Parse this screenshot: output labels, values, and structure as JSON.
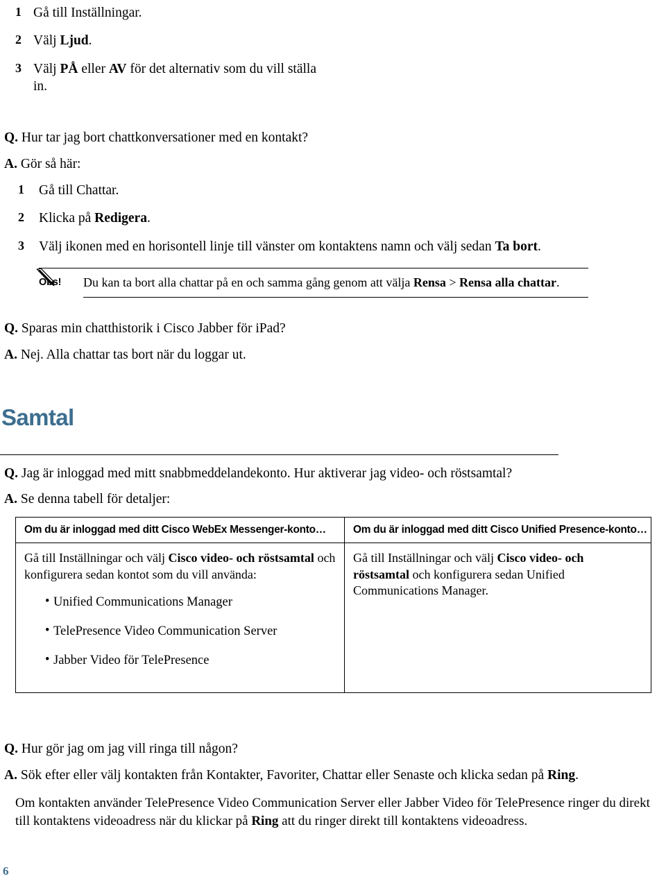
{
  "document": {
    "page_number": "6",
    "accent_color": "#3c6e8f",
    "text_color": "#000000"
  },
  "top_steps": {
    "items": [
      {
        "num": "1",
        "text_plain": "Gå till Inställningar.",
        "text_html": "Gå till Inställningar."
      },
      {
        "num": "2",
        "text_plain": "Välj Ljud.",
        "text_html": "Välj <b>Ljud</b>."
      },
      {
        "num": "3",
        "text_plain": "Välj PÅ eller AV för det alternativ som du vill ställa in.",
        "text_html": "Välj <b>PÅ</b> eller <b>AV</b> för det alternativ som du vill ställa in."
      }
    ]
  },
  "faq_chat_delete": {
    "question_tag": "Q.",
    "question": "Hur tar jag bort chattkonversationer med en kontakt?",
    "answer_tag": "A.",
    "answer": "Gör så här:",
    "steps": [
      {
        "num": "1",
        "text_plain": "Gå till Chattar.",
        "text_html": "Gå till Chattar."
      },
      {
        "num": "2",
        "text_plain": "Klicka på Redigera.",
        "text_html": "Klicka på <b>Redigera</b>."
      },
      {
        "num": "3",
        "text_plain": "Välj ikonen med en horisontell linje till vänster om kontaktens namn och välj sedan Ta bort.",
        "text_html": "Välj ikonen med en horisontell linje till vänster om kontaktens namn och välj sedan <b>Ta bort</b>."
      }
    ]
  },
  "note": {
    "icon": "pencil-icon",
    "label": "Obs!",
    "text_plain": "Du kan ta bort alla chattar på en och samma gång genom att välja Rensa > Rensa alla chattar.",
    "text_html": "Du kan ta bort alla chattar på en och samma gång genom att välja <b>Rensa</b> &gt; <b>Rensa alla chattar</b>."
  },
  "faq_chat_history": {
    "question_tag": "Q.",
    "question": "Sparas min chatthistorik i Cisco Jabber för iPad?",
    "answer_tag": "A.",
    "answer": "Nej. Alla chattar tas bort när du loggar ut."
  },
  "section": {
    "heading": "Samtal"
  },
  "faq_video_voice": {
    "question_tag": "Q.",
    "question": "Jag är inloggad med mitt snabbmeddelandekonto. Hur aktiverar jag video- och röstsamtal?",
    "answer_tag": "A.",
    "answer": "Se denna tabell för detaljer:"
  },
  "account_table": {
    "headers": [
      "Om du är inloggad med ditt Cisco WebEx Messenger-konto…",
      "Om du är inloggad med ditt Cisco Unified Presence-konto…"
    ],
    "rows": [
      {
        "left": {
          "text_plain": "Gå till Inställningar och välj Cisco video- och röstsamtal och konfigurera sedan kontot som du vill använda:",
          "text_html": "Gå till Inställningar och välj <b>Cisco video- och röstsamtal</b> och konfigurera sedan kontot som du vill använda:",
          "bullets": [
            "Unified Communications Manager",
            "TelePresence Video Communication Server",
            "Jabber Video för TelePresence"
          ]
        },
        "right": {
          "text_plain": "Gå till Inställningar och välj Cisco video- och röstsamtal och konfigurera sedan Unified Communications Manager.",
          "text_html": "Gå till Inställningar och välj <b>Cisco video- och röstsamtal</b> och konfigurera sedan Unified Communications Manager.",
          "bullets": []
        }
      }
    ]
  },
  "faq_make_call": {
    "question_tag": "Q.",
    "question": "Hur gör jag om jag vill ringa till någon?",
    "answer_tag": "A.",
    "answer_plain": "Sök efter eller välj kontakten från Kontakter, Favoriter, Chattar eller Senaste och klicka sedan på Ring.",
    "answer_html": "Sök efter eller välj kontakten från Kontakter, Favoriter, Chattar eller Senaste och klicka sedan på <b>Ring</b>.",
    "paragraph_plain": "Om kontakten använder TelePresence Video Communication Server eller Jabber Video för TelePresence ringer du direkt till kontaktens videoadress när du klickar på Ring att du ringer direkt till kontaktens videoadress.",
    "paragraph_html": "Om kontakten använder TelePresence Video Communication Server eller Jabber Video för TelePresence ringer du direkt till kontaktens videoadress när du klickar på <b>Ring</b> att du ringer direkt till kontaktens videoadress."
  }
}
